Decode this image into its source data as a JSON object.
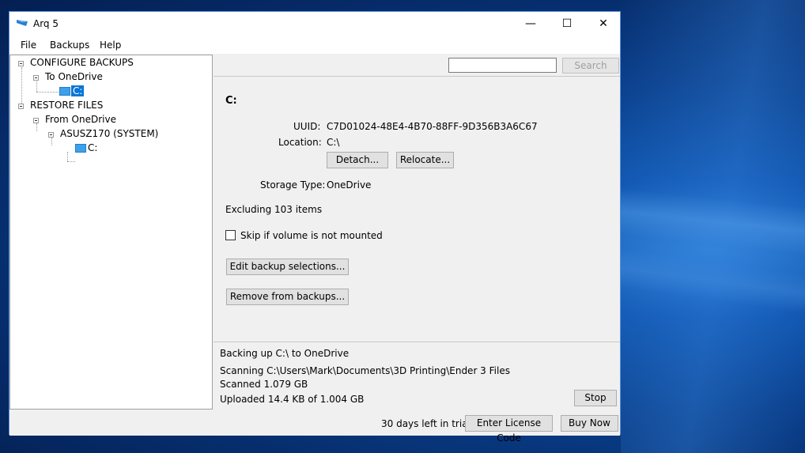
{
  "window": {
    "title": "Arq 5",
    "controls": {
      "minimize": "—",
      "maximize": "☐",
      "close": "✕"
    }
  },
  "menu": [
    "File",
    "Backups",
    "Help"
  ],
  "tree": {
    "configure": "CONFIGURE BACKUPS",
    "to_onedrive": "To OneDrive",
    "c_selected": "C:",
    "restore": "RESTORE FILES",
    "from_onedrive": "From OneDrive",
    "system": "ASUSZ170 (SYSTEM)",
    "c_restore": "C:"
  },
  "search": {
    "placeholder": "",
    "button": "Search"
  },
  "detail": {
    "heading": "C:",
    "uuid_label": "UUID:",
    "uuid_value": "C7D01024-48E4-4B70-88FF-9D356B3A6C67",
    "location_label": "Location:",
    "location_value": "C:\\",
    "detach": "Detach...",
    "relocate": "Relocate...",
    "storage_label": "Storage Type:",
    "storage_value": "OneDrive",
    "excluding": "Excluding 103 items",
    "skip_label": "Skip if volume is not mounted",
    "edit_button": "Edit backup selections...",
    "remove_button": "Remove from backups..."
  },
  "status": {
    "line1": "Backing up C:\\ to OneDrive",
    "line2": "Scanning C:\\Users\\Mark\\Documents\\3D Printing\\Ender 3 Files",
    "line3": "Scanned 1.079 GB",
    "line4": "Uploaded 14.4 KB of 1.004 GB",
    "stop": "Stop"
  },
  "footer": {
    "trial": "30 days left in trial",
    "license": "Enter License Code",
    "buy": "Buy Now"
  }
}
